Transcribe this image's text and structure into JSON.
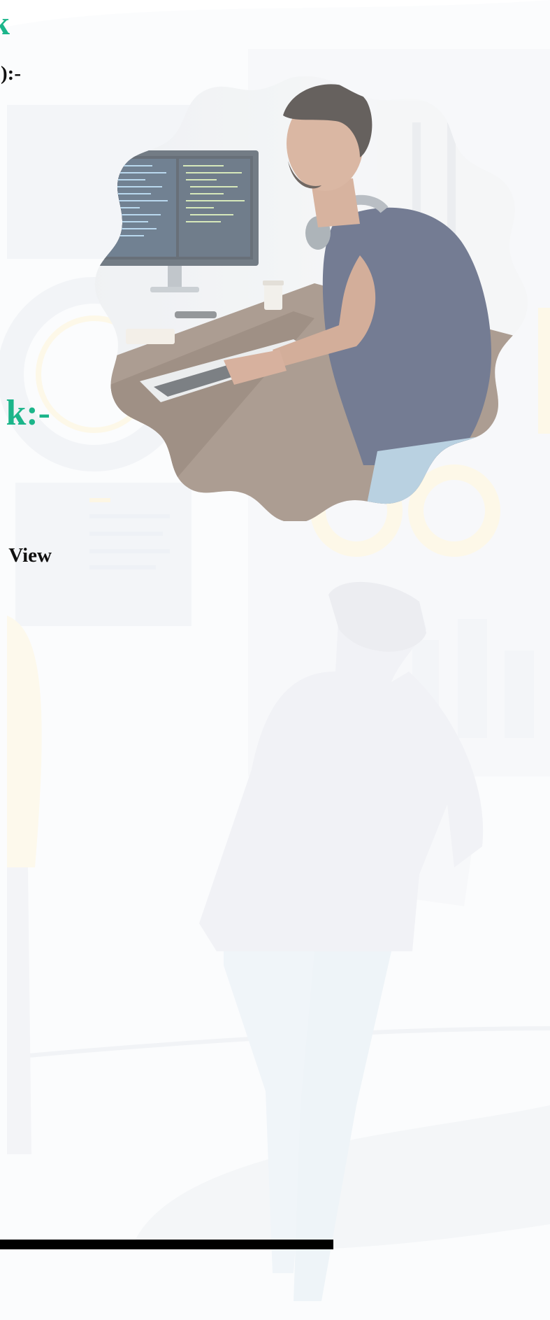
{
  "headings": {
    "top_heading": "k",
    "subheading": "):-",
    "middle_heading": "k:-",
    "view_text": "View"
  },
  "colors": {
    "accent_green": "#1bb58a",
    "text_dark": "#111111",
    "bar": "#000000"
  },
  "image": {
    "subject": "man-coding-at-desk-photo",
    "shape": "wavy-circle"
  }
}
